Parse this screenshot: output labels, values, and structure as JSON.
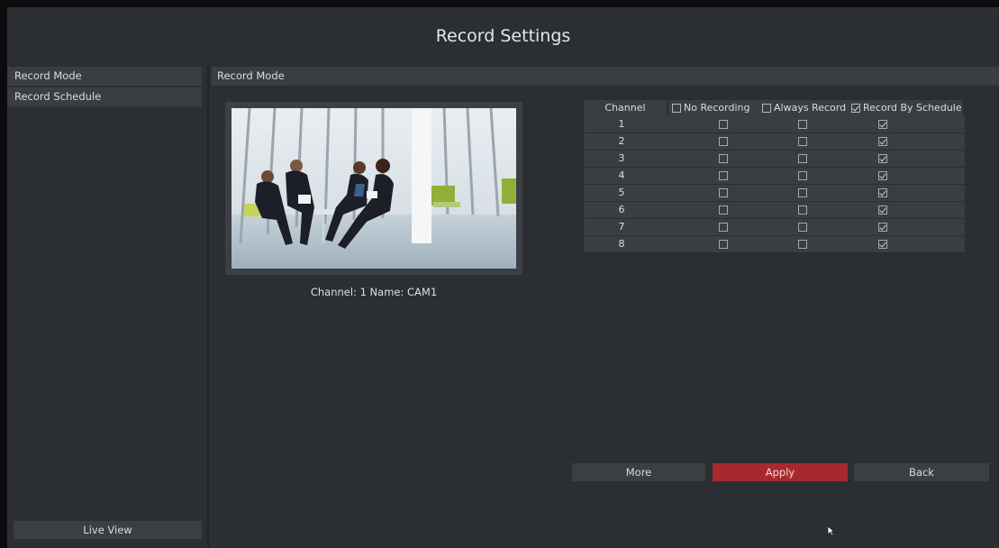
{
  "window": {
    "title": "Record Settings"
  },
  "sidebar": {
    "items": [
      {
        "label": "Record Mode"
      },
      {
        "label": "Record Schedule"
      }
    ],
    "live_view_label": "Live View"
  },
  "main": {
    "section_title": "Record Mode",
    "preview": {
      "caption": "Channel: 1 Name: CAM1",
      "image": "office-meeting-photo"
    },
    "table": {
      "headers": {
        "channel": "Channel",
        "no_recording": "No Recording",
        "always_record": "Always Record",
        "record_by_schedule": "Record By Schedule"
      },
      "header_checked": {
        "no_recording": false,
        "always_record": false,
        "record_by_schedule": true
      },
      "rows": [
        {
          "channel": "1",
          "no_recording": false,
          "always_record": false,
          "record_by_schedule": true
        },
        {
          "channel": "2",
          "no_recording": false,
          "always_record": false,
          "record_by_schedule": true
        },
        {
          "channel": "3",
          "no_recording": false,
          "always_record": false,
          "record_by_schedule": true
        },
        {
          "channel": "4",
          "no_recording": false,
          "always_record": false,
          "record_by_schedule": true
        },
        {
          "channel": "5",
          "no_recording": false,
          "always_record": false,
          "record_by_schedule": true
        },
        {
          "channel": "6",
          "no_recording": false,
          "always_record": false,
          "record_by_schedule": true
        },
        {
          "channel": "7",
          "no_recording": false,
          "always_record": false,
          "record_by_schedule": true
        },
        {
          "channel": "8",
          "no_recording": false,
          "always_record": false,
          "record_by_schedule": true
        }
      ]
    }
  },
  "footer": {
    "more_label": "More",
    "apply_label": "Apply",
    "back_label": "Back"
  },
  "colors": {
    "background": "#2b2e32",
    "panel": "#3a3d42",
    "apply_accent": "#a8292d"
  }
}
